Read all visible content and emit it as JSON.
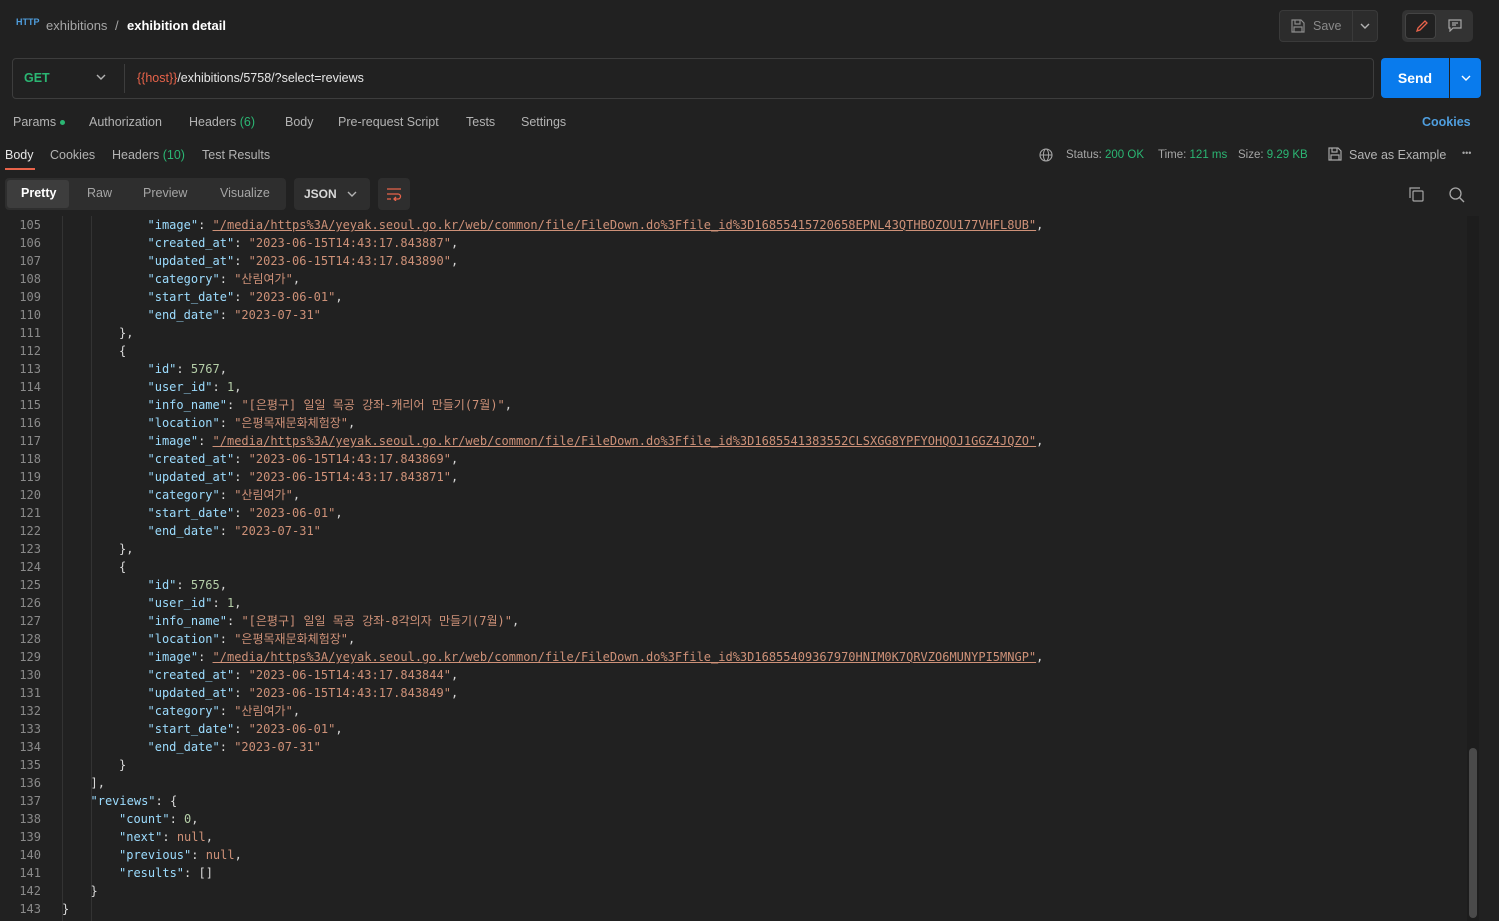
{
  "breadcrumb": {
    "parent": "exhibitions",
    "separator": "/",
    "current": "exhibition detail"
  },
  "http_icon": "HTTP",
  "header": {
    "save_label": "Save"
  },
  "request": {
    "method": "GET",
    "url_var": "{{host}}",
    "url_path": "/exhibitions/5758/?select=reviews",
    "send_label": "Send"
  },
  "request_tabs": [
    "Params",
    "Authorization",
    "Headers",
    "Body",
    "Pre-request Script",
    "Tests",
    "Settings"
  ],
  "headers_count": "(6)",
  "cookies_label": "Cookies",
  "response_tabs": {
    "body": "Body",
    "cookies": "Cookies",
    "headers": "Headers",
    "headers_count": "(10)",
    "tests": "Test Results"
  },
  "status": {
    "status_label": "Status:",
    "status_value": "200 OK",
    "time_label": "Time:",
    "time_value": "121 ms",
    "size_label": "Size:",
    "size_value": "9.29 KB",
    "save_example": "Save as Example",
    "more": "•••"
  },
  "view_tabs": [
    "Pretty",
    "Raw",
    "Preview",
    "Visualize"
  ],
  "format": "JSON",
  "colors": {
    "accent": "#e8634a",
    "send": "#097bed",
    "green": "#2bb673",
    "link": "#4f9ede"
  },
  "code_lines": [
    {
      "n": "105",
      "i": 4,
      "t": [
        [
          "k",
          "\"image\""
        ],
        [
          "p",
          ": "
        ],
        [
          "u",
          "\"/media/https%3A/yeyak.seoul.go.kr/web/common/file/FileDown.do%3Ffile_id%3D16855415720658EPNL43QTHBOZOU177VHFL8UB\""
        ],
        [
          "p",
          ","
        ]
      ]
    },
    {
      "n": "106",
      "i": 4,
      "t": [
        [
          "k",
          "\"created_at\""
        ],
        [
          "p",
          ": "
        ],
        [
          "s",
          "\"2023-06-15T14:43:17.843887\""
        ],
        [
          "p",
          ","
        ]
      ]
    },
    {
      "n": "107",
      "i": 4,
      "t": [
        [
          "k",
          "\"updated_at\""
        ],
        [
          "p",
          ": "
        ],
        [
          "s",
          "\"2023-06-15T14:43:17.843890\""
        ],
        [
          "p",
          ","
        ]
      ]
    },
    {
      "n": "108",
      "i": 4,
      "t": [
        [
          "k",
          "\"category\""
        ],
        [
          "p",
          ": "
        ],
        [
          "s",
          "\"산림여가\""
        ],
        [
          "p",
          ","
        ]
      ]
    },
    {
      "n": "109",
      "i": 4,
      "t": [
        [
          "k",
          "\"start_date\""
        ],
        [
          "p",
          ": "
        ],
        [
          "s",
          "\"2023-06-01\""
        ],
        [
          "p",
          ","
        ]
      ]
    },
    {
      "n": "110",
      "i": 4,
      "t": [
        [
          "k",
          "\"end_date\""
        ],
        [
          "p",
          ": "
        ],
        [
          "s",
          "\"2023-07-31\""
        ]
      ]
    },
    {
      "n": "111",
      "i": 3,
      "t": [
        [
          "p",
          "},"
        ]
      ]
    },
    {
      "n": "112",
      "i": 3,
      "t": [
        [
          "p",
          "{"
        ]
      ]
    },
    {
      "n": "113",
      "i": 4,
      "t": [
        [
          "k",
          "\"id\""
        ],
        [
          "p",
          ": "
        ],
        [
          "n",
          "5767"
        ],
        [
          "p",
          ","
        ]
      ]
    },
    {
      "n": "114",
      "i": 4,
      "t": [
        [
          "k",
          "\"user_id\""
        ],
        [
          "p",
          ": "
        ],
        [
          "n",
          "1"
        ],
        [
          "p",
          ","
        ]
      ]
    },
    {
      "n": "115",
      "i": 4,
      "t": [
        [
          "k",
          "\"info_name\""
        ],
        [
          "p",
          ": "
        ],
        [
          "s",
          "\"[은평구] 일일 목공 강좌-캐리어 만들기(7월)\""
        ],
        [
          "p",
          ","
        ]
      ]
    },
    {
      "n": "116",
      "i": 4,
      "t": [
        [
          "k",
          "\"location\""
        ],
        [
          "p",
          ": "
        ],
        [
          "s",
          "\"은평목재문화체험장\""
        ],
        [
          "p",
          ","
        ]
      ]
    },
    {
      "n": "117",
      "i": 4,
      "t": [
        [
          "k",
          "\"image\""
        ],
        [
          "p",
          ": "
        ],
        [
          "u",
          "\"/media/https%3A/yeyak.seoul.go.kr/web/common/file/FileDown.do%3Ffile_id%3D1685541383552CLSXGG8YPFYOHQOJ1GGZ4JQZO\""
        ],
        [
          "p",
          ","
        ]
      ]
    },
    {
      "n": "118",
      "i": 4,
      "t": [
        [
          "k",
          "\"created_at\""
        ],
        [
          "p",
          ": "
        ],
        [
          "s",
          "\"2023-06-15T14:43:17.843869\""
        ],
        [
          "p",
          ","
        ]
      ]
    },
    {
      "n": "119",
      "i": 4,
      "t": [
        [
          "k",
          "\"updated_at\""
        ],
        [
          "p",
          ": "
        ],
        [
          "s",
          "\"2023-06-15T14:43:17.843871\""
        ],
        [
          "p",
          ","
        ]
      ]
    },
    {
      "n": "120",
      "i": 4,
      "t": [
        [
          "k",
          "\"category\""
        ],
        [
          "p",
          ": "
        ],
        [
          "s",
          "\"산림여가\""
        ],
        [
          "p",
          ","
        ]
      ]
    },
    {
      "n": "121",
      "i": 4,
      "t": [
        [
          "k",
          "\"start_date\""
        ],
        [
          "p",
          ": "
        ],
        [
          "s",
          "\"2023-06-01\""
        ],
        [
          "p",
          ","
        ]
      ]
    },
    {
      "n": "122",
      "i": 4,
      "t": [
        [
          "k",
          "\"end_date\""
        ],
        [
          "p",
          ": "
        ],
        [
          "s",
          "\"2023-07-31\""
        ]
      ]
    },
    {
      "n": "123",
      "i": 3,
      "t": [
        [
          "p",
          "},"
        ]
      ]
    },
    {
      "n": "124",
      "i": 3,
      "t": [
        [
          "p",
          "{"
        ]
      ]
    },
    {
      "n": "125",
      "i": 4,
      "t": [
        [
          "k",
          "\"id\""
        ],
        [
          "p",
          ": "
        ],
        [
          "n",
          "5765"
        ],
        [
          "p",
          ","
        ]
      ]
    },
    {
      "n": "126",
      "i": 4,
      "t": [
        [
          "k",
          "\"user_id\""
        ],
        [
          "p",
          ": "
        ],
        [
          "n",
          "1"
        ],
        [
          "p",
          ","
        ]
      ]
    },
    {
      "n": "127",
      "i": 4,
      "t": [
        [
          "k",
          "\"info_name\""
        ],
        [
          "p",
          ": "
        ],
        [
          "s",
          "\"[은평구] 일일 목공 강좌-8각의자 만들기(7월)\""
        ],
        [
          "p",
          ","
        ]
      ]
    },
    {
      "n": "128",
      "i": 4,
      "t": [
        [
          "k",
          "\"location\""
        ],
        [
          "p",
          ": "
        ],
        [
          "s",
          "\"은평목재문화체험장\""
        ],
        [
          "p",
          ","
        ]
      ]
    },
    {
      "n": "129",
      "i": 4,
      "t": [
        [
          "k",
          "\"image\""
        ],
        [
          "p",
          ": "
        ],
        [
          "u",
          "\"/media/https%3A/yeyak.seoul.go.kr/web/common/file/FileDown.do%3Ffile_id%3D16855409367970HNIM0K7QRVZO6MUNYPI5MNGP\""
        ],
        [
          "p",
          ","
        ]
      ]
    },
    {
      "n": "130",
      "i": 4,
      "t": [
        [
          "k",
          "\"created_at\""
        ],
        [
          "p",
          ": "
        ],
        [
          "s",
          "\"2023-06-15T14:43:17.843844\""
        ],
        [
          "p",
          ","
        ]
      ]
    },
    {
      "n": "131",
      "i": 4,
      "t": [
        [
          "k",
          "\"updated_at\""
        ],
        [
          "p",
          ": "
        ],
        [
          "s",
          "\"2023-06-15T14:43:17.843849\""
        ],
        [
          "p",
          ","
        ]
      ]
    },
    {
      "n": "132",
      "i": 4,
      "t": [
        [
          "k",
          "\"category\""
        ],
        [
          "p",
          ": "
        ],
        [
          "s",
          "\"산림여가\""
        ],
        [
          "p",
          ","
        ]
      ]
    },
    {
      "n": "133",
      "i": 4,
      "t": [
        [
          "k",
          "\"start_date\""
        ],
        [
          "p",
          ": "
        ],
        [
          "s",
          "\"2023-06-01\""
        ],
        [
          "p",
          ","
        ]
      ]
    },
    {
      "n": "134",
      "i": 4,
      "t": [
        [
          "k",
          "\"end_date\""
        ],
        [
          "p",
          ": "
        ],
        [
          "s",
          "\"2023-07-31\""
        ]
      ]
    },
    {
      "n": "135",
      "i": 3,
      "t": [
        [
          "p",
          "}"
        ]
      ]
    },
    {
      "n": "136",
      "i": 2,
      "t": [
        [
          "p",
          "],"
        ]
      ]
    },
    {
      "n": "137",
      "i": 2,
      "t": [
        [
          "k",
          "\"reviews\""
        ],
        [
          "p",
          ": {"
        ]
      ]
    },
    {
      "n": "138",
      "i": 3,
      "t": [
        [
          "k",
          "\"count\""
        ],
        [
          "p",
          ": "
        ],
        [
          "n",
          "0"
        ],
        [
          "p",
          ","
        ]
      ]
    },
    {
      "n": "139",
      "i": 3,
      "t": [
        [
          "k",
          "\"next\""
        ],
        [
          "p",
          ": "
        ],
        [
          "s",
          "null"
        ],
        [
          "p",
          ","
        ]
      ]
    },
    {
      "n": "140",
      "i": 3,
      "t": [
        [
          "k",
          "\"previous\""
        ],
        [
          "p",
          ": "
        ],
        [
          "s",
          "null"
        ],
        [
          "p",
          ","
        ]
      ]
    },
    {
      "n": "141",
      "i": 3,
      "t": [
        [
          "k",
          "\"results\""
        ],
        [
          "p",
          ": []"
        ]
      ]
    },
    {
      "n": "142",
      "i": 2,
      "t": [
        [
          "p",
          "}"
        ]
      ]
    },
    {
      "n": "143",
      "i": 1,
      "t": [
        [
          "p",
          "}"
        ]
      ]
    }
  ]
}
